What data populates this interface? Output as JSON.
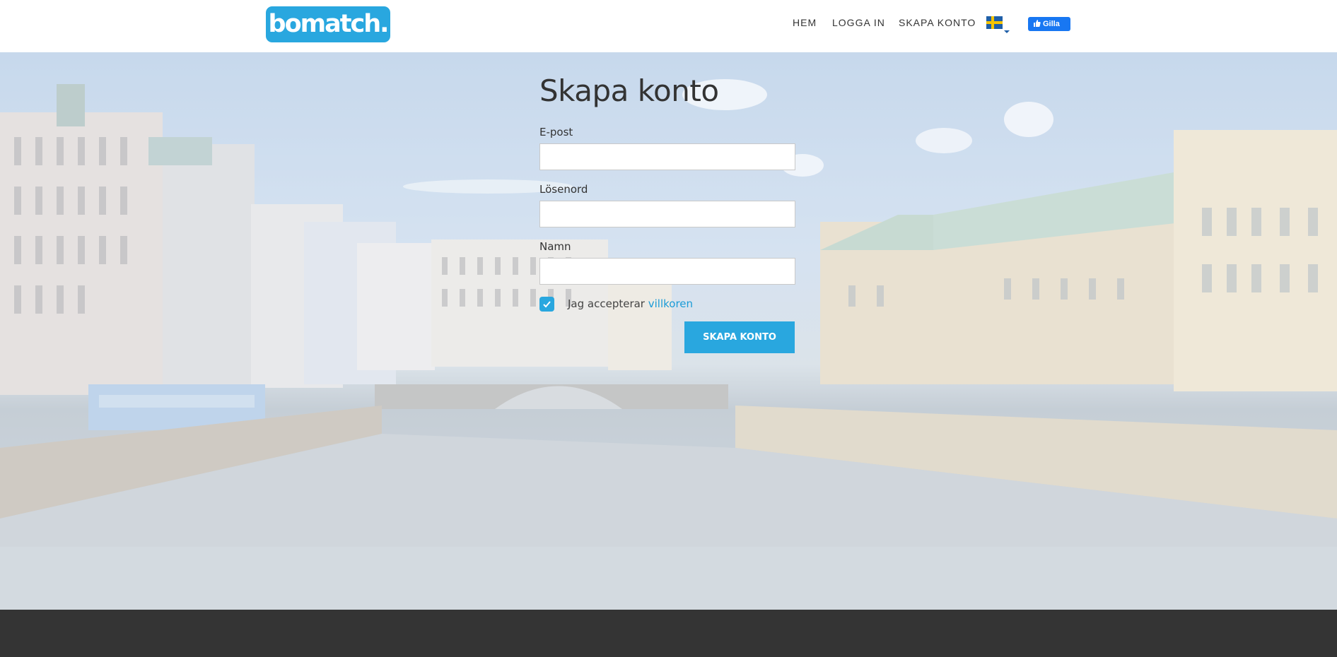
{
  "header": {
    "logo_text": "bomatch.",
    "nav": {
      "home": "HEM",
      "login": "LOGGA IN",
      "create_account": "SKAPA KONTO"
    },
    "language_flag": "sweden-flag-icon",
    "fb_like_label": "Gilla"
  },
  "form": {
    "title": "Skapa konto",
    "email_label": "E-post",
    "email_value": "",
    "password_label": "Lösenord",
    "password_value": "",
    "name_label": "Namn",
    "name_value": "",
    "terms_checked": true,
    "terms_text": "Jag accepterar ",
    "terms_link": "villkoren",
    "submit_label": "SKAPA KONTO"
  },
  "colors": {
    "accent": "#29a7df",
    "footer": "#343434",
    "facebook": "#1877f2"
  }
}
